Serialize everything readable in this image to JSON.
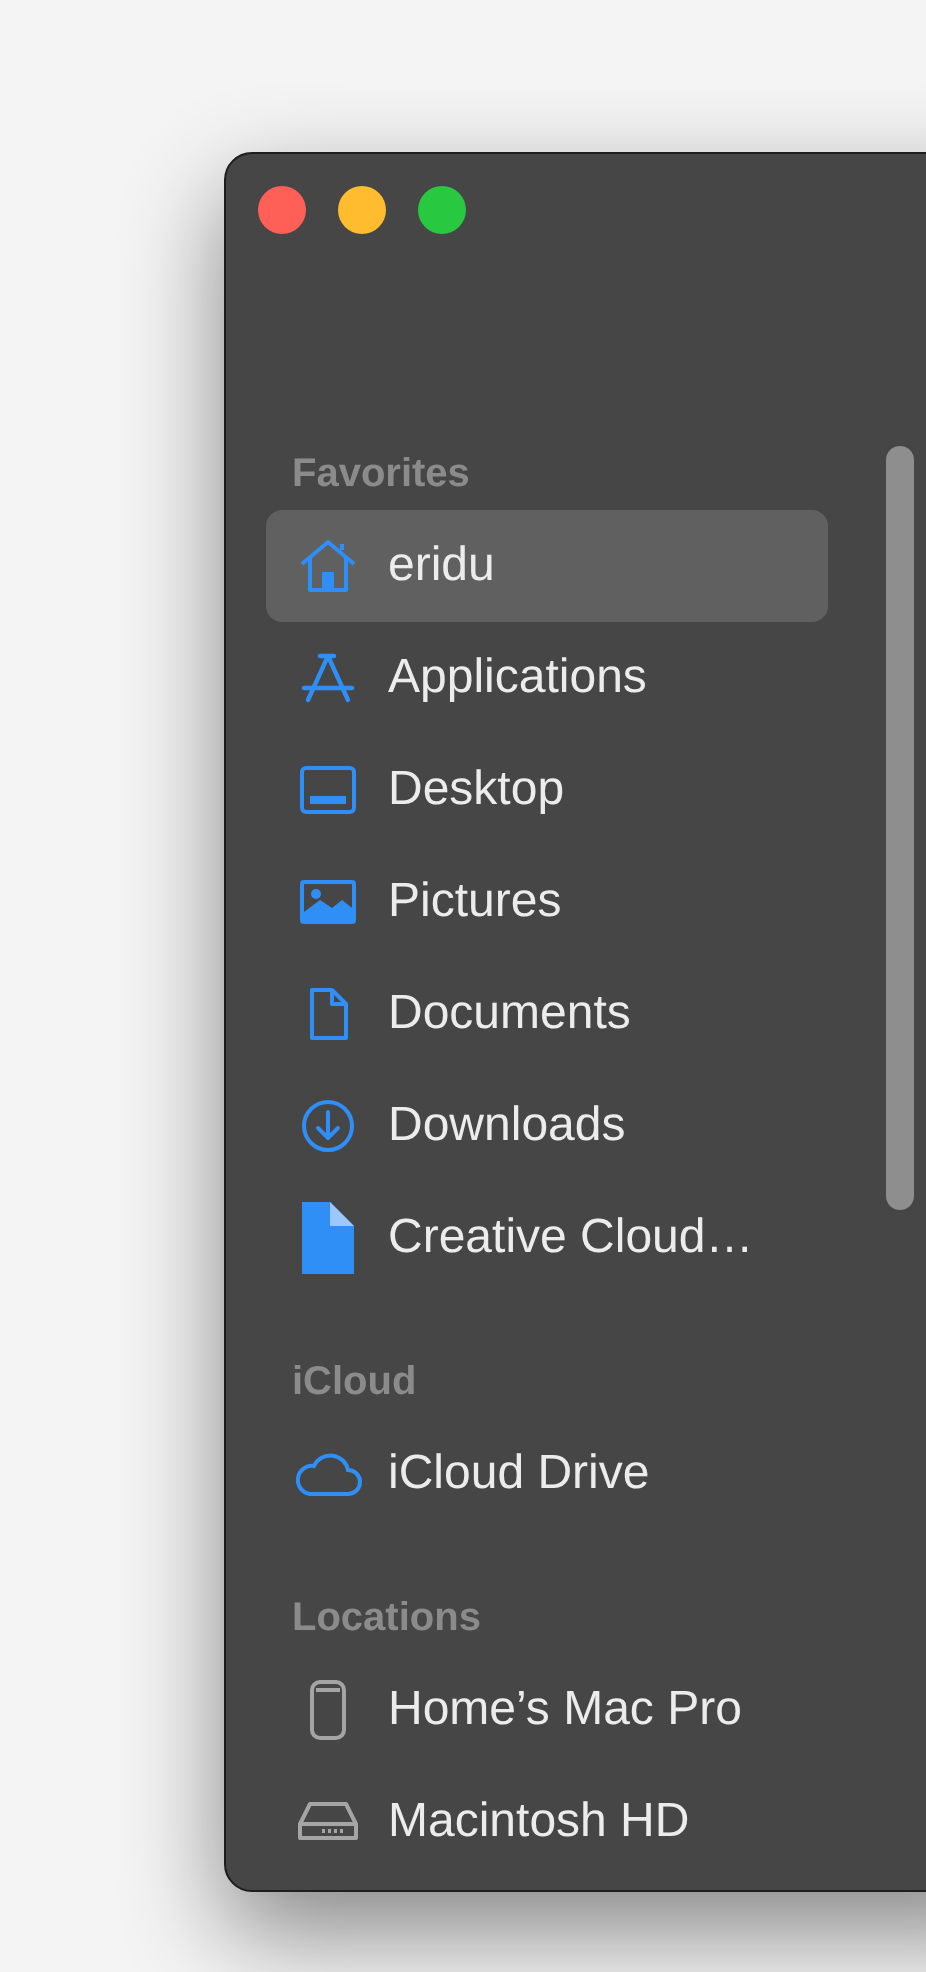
{
  "window": {
    "controls": [
      {
        "color": "#fe5f57"
      },
      {
        "color": "#febc2e"
      },
      {
        "color": "#28c840"
      }
    ]
  },
  "sidebar": {
    "sections": [
      {
        "title": "Favorites",
        "items": [
          {
            "label": "eridu",
            "kind": "home",
            "selected": true
          },
          {
            "label": "Applications",
            "kind": "apps",
            "selected": false
          },
          {
            "label": "Desktop",
            "kind": "desktop",
            "selected": false
          },
          {
            "label": "Pictures",
            "kind": "pictures",
            "selected": false
          },
          {
            "label": "Documents",
            "kind": "document",
            "selected": false
          },
          {
            "label": "Downloads",
            "kind": "download",
            "selected": false
          },
          {
            "label": "Creative Cloud…",
            "kind": "file",
            "selected": false
          }
        ]
      },
      {
        "title": "iCloud",
        "items": [
          {
            "label": "iCloud Drive",
            "kind": "cloud",
            "selected": false
          }
        ]
      },
      {
        "title": "Locations",
        "items": [
          {
            "label": "Home’s Mac Pro",
            "kind": "cylinder",
            "selected": false
          },
          {
            "label": "Macintosh HD",
            "kind": "disk",
            "selected": false
          }
        ]
      }
    ]
  }
}
